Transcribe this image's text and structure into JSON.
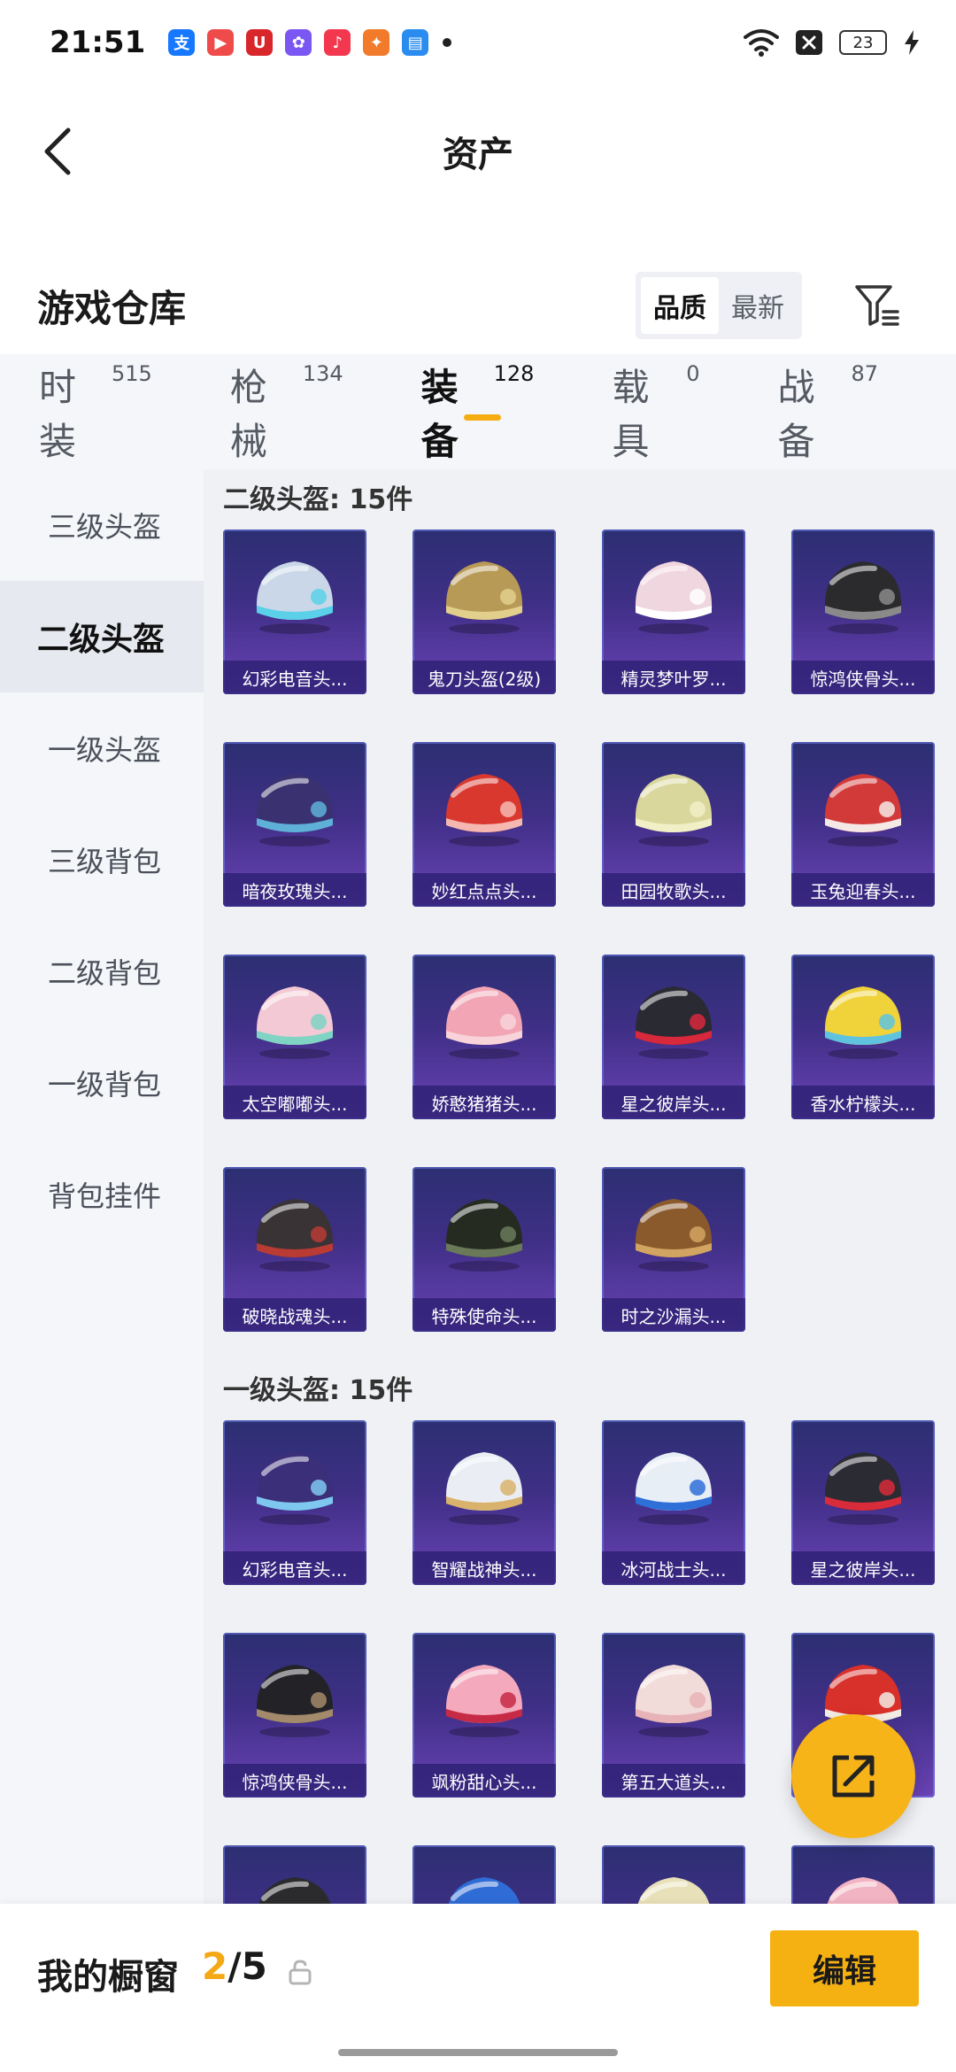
{
  "status_bar": {
    "time": "21:51",
    "battery": "23",
    "apps": [
      {
        "icon": "alipay-icon",
        "glyph": "支",
        "color": "#1677ff"
      },
      {
        "icon": "video-icon",
        "glyph": "▶",
        "color": "#ef4b4b"
      },
      {
        "icon": "red-app-icon",
        "glyph": "U",
        "color": "#d8262b"
      },
      {
        "icon": "photos-icon",
        "glyph": "✿",
        "color": "#7a57f2"
      },
      {
        "icon": "music-icon",
        "glyph": "♪",
        "color": "#f2374f"
      },
      {
        "icon": "game-icon",
        "glyph": "✦",
        "color": "#f17b2b"
      },
      {
        "icon": "files-icon",
        "glyph": "▤",
        "color": "#2b8cf0"
      }
    ]
  },
  "nav": {
    "title": "资产"
  },
  "warehouse": {
    "title": "游戏仓库",
    "sort_options": [
      "品质",
      "最新"
    ],
    "active_sort": "品质"
  },
  "tabs": [
    {
      "label": "时装",
      "count": "515"
    },
    {
      "label": "枪械",
      "count": "134"
    },
    {
      "label": "装备",
      "count": "128",
      "active": true
    },
    {
      "label": "载具",
      "count": "0"
    },
    {
      "label": "战备",
      "count": "87"
    }
  ],
  "side_menu": [
    {
      "label": "三级头盔"
    },
    {
      "label": "二级头盔",
      "active": true
    },
    {
      "label": "一级头盔"
    },
    {
      "label": "三级背包"
    },
    {
      "label": "二级背包"
    },
    {
      "label": "一级背包"
    },
    {
      "label": "背包挂件"
    }
  ],
  "sections": [
    {
      "title": "二级头盔: 15件",
      "items": [
        {
          "name": "幻彩电音头...",
          "color": "#c9d7e8",
          "accent": "#5ad1e8"
        },
        {
          "name": "鬼刀头盔(2级)",
          "color": "#b89a57",
          "accent": "#e3cf8c"
        },
        {
          "name": "精灵梦叶罗...",
          "color": "#f0d6df",
          "accent": "#ffffff"
        },
        {
          "name": "惊鸿侠骨头...",
          "color": "#2b2b2e",
          "accent": "#8a8a8a"
        },
        {
          "name": "暗夜玫瑰头...",
          "color": "#3a3270",
          "accent": "#5fb0d8"
        },
        {
          "name": "妙红点点头...",
          "color": "#d9382f",
          "accent": "#f4b8b0"
        },
        {
          "name": "田园牧歌头...",
          "color": "#d9d79c",
          "accent": "#f0efc6"
        },
        {
          "name": "玉兔迎春头...",
          "color": "#d23a3a",
          "accent": "#f5e9e6"
        },
        {
          "name": "太空嘟嘟头...",
          "color": "#f3c9d6",
          "accent": "#7fd4c4"
        },
        {
          "name": "娇憨猪猪头...",
          "color": "#f2a5b5",
          "accent": "#f8d3da"
        },
        {
          "name": "星之彼岸头...",
          "color": "#2a2a33",
          "accent": "#d8283c"
        },
        {
          "name": "香水柠檬头...",
          "color": "#f0d33a",
          "accent": "#5fc3e0"
        },
        {
          "name": "破晓战魂头...",
          "color": "#3a3336",
          "accent": "#b93b34"
        },
        {
          "name": "特殊使命头...",
          "color": "#262b22",
          "accent": "#6a7a58"
        },
        {
          "name": "时之沙漏头...",
          "color": "#8a5a2c",
          "accent": "#d2a461"
        }
      ]
    },
    {
      "title": "一级头盔: 15件",
      "items": [
        {
          "name": "幻彩电音头...",
          "color": "#3c2f7a",
          "accent": "#7ec8f0"
        },
        {
          "name": "智耀战神头...",
          "color": "#eaeef4",
          "accent": "#d9b36c"
        },
        {
          "name": "冰河战士头...",
          "color": "#e8eef6",
          "accent": "#2f6fd8"
        },
        {
          "name": "星之彼岸头...",
          "color": "#2b2b33",
          "accent": "#d82c3a"
        },
        {
          "name": "惊鸿侠骨头...",
          "color": "#232327",
          "accent": "#a28a6a"
        },
        {
          "name": "飒粉甜心头...",
          "color": "#f4a9bd",
          "accent": "#c62a45"
        },
        {
          "name": "第五大道头...",
          "color": "#f2dcd9",
          "accent": "#e7b3b6"
        },
        {
          "name": "",
          "color": "#d8302b",
          "accent": "#f3ece4"
        },
        {
          "name": "",
          "color": "#2b2a2d",
          "accent": "#caa64a"
        },
        {
          "name": "",
          "color": "#2f6cd6",
          "accent": "#8fc0f0"
        },
        {
          "name": "",
          "color": "#e8e0b8",
          "accent": "#f7f2da"
        },
        {
          "name": "",
          "color": "#f2b3c2",
          "accent": "#fadbe2"
        }
      ]
    }
  ],
  "bottom": {
    "window_label": "我的橱窗",
    "window_current": "2",
    "window_total": "/5",
    "edit_label": "编辑"
  }
}
